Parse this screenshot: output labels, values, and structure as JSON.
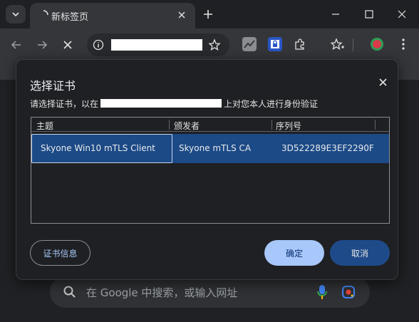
{
  "tab": {
    "title": "新标签页"
  },
  "ntp": {
    "search_placeholder": "在 Google 中搜索，或输入网址"
  },
  "dialog": {
    "title": "选择证书",
    "desc_prefix": "请选择证书，以在",
    "desc_suffix": "上对您本人进行身份验证",
    "table": {
      "columns": [
        "主题",
        "颁发者",
        "序列号"
      ],
      "rows": [
        {
          "subject": "Skyone Win10 mTLS Client",
          "issuer": "Skyone mTLS CA",
          "serial": "3D522289E3EF2290F"
        }
      ]
    },
    "buttons": {
      "info": "证书信息",
      "ok": "确定",
      "cancel": "取消"
    }
  },
  "colors": {
    "accent": "#a8c7fa",
    "selected_row": "#1c4a86",
    "dialog_bg": "#1f2023"
  }
}
